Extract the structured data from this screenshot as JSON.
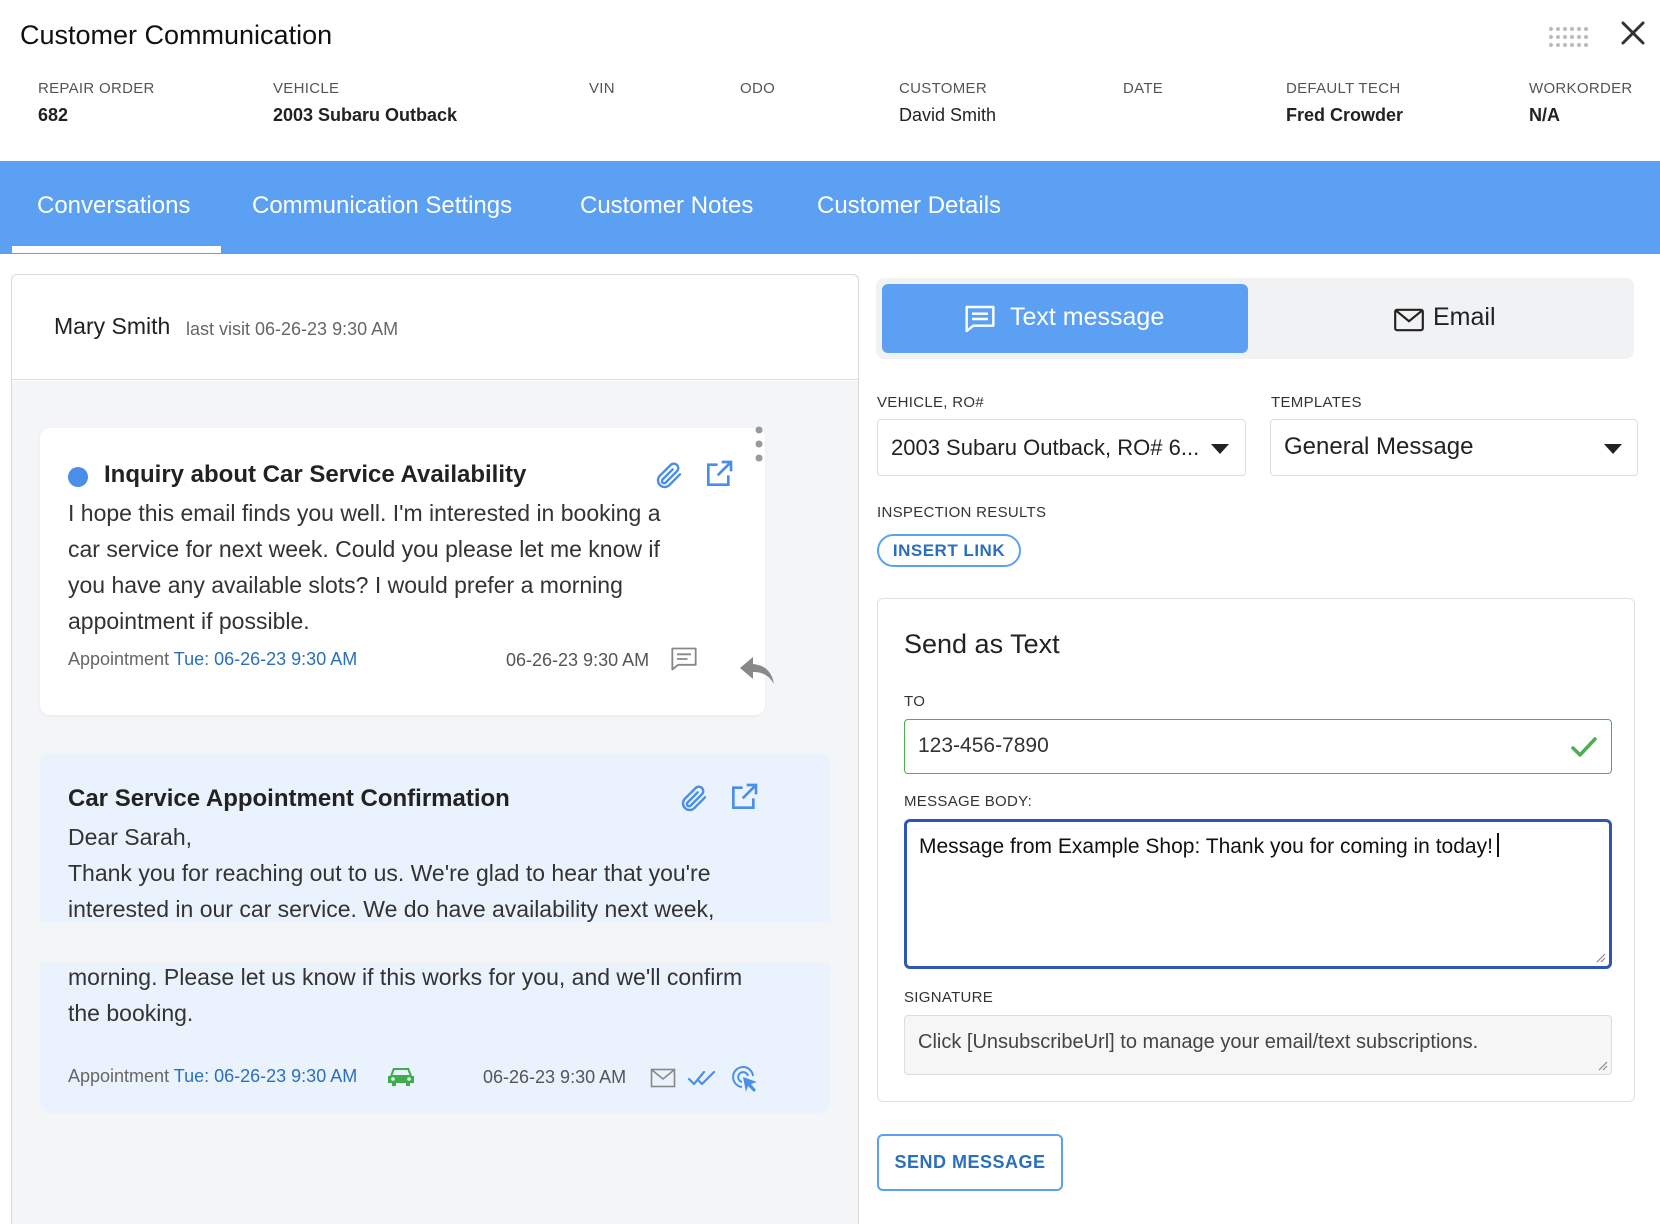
{
  "window": {
    "title": "Customer Communication"
  },
  "meta": [
    {
      "label": "REPAIR ORDER",
      "value": "682"
    },
    {
      "label": "VEHICLE",
      "value": "2003 Subaru Outback"
    },
    {
      "label": "VIN",
      "value": ""
    },
    {
      "label": "ODO",
      "value": ""
    },
    {
      "label": "CUSTOMER",
      "value": "David Smith"
    },
    {
      "label": "DATE",
      "value": ""
    },
    {
      "label": "DEFAULT TECH",
      "value": "Fred Crowder"
    },
    {
      "label": "WORKORDER",
      "value": "N/A"
    }
  ],
  "tabs": [
    {
      "label": "Conversations",
      "active": true
    },
    {
      "label": "Communication Settings"
    },
    {
      "label": "Customer Notes"
    },
    {
      "label": "Customer Details"
    }
  ],
  "conversation": {
    "contact_name": "Mary Smith",
    "last_visit": "last visit 06-26-23 9:30 AM",
    "messages": [
      {
        "subject": "Inquiry about Car Service Availability",
        "unread": true,
        "body_lines": [
          "I hope this email finds you well. I'm interested in booking a",
          "car service for next week. Could you please let me know if",
          "you have any available slots? I would prefer a morning",
          "appointment if possible."
        ],
        "appointment_label": "Appointment",
        "appointment_value": "Tue: 06-26-23 9:30 AM",
        "timestamp": "06-26-23 9:30 AM",
        "channel_icon": "chat-icon"
      },
      {
        "subject": "Car Service Appointment Confirmation",
        "body_lines": [
          "Dear Sarah,",
          "Thank you for reaching out to us. We're glad to hear that you're",
          "interested in our car service. We do have availability next week,",
          "morning. Please let us know if this works for you, and we'll confirm",
          "the booking."
        ],
        "appointment_label": "Appointment",
        "appointment_value": "Tue: 06-26-23 9:30 AM",
        "timestamp": "06-26-23 9:30 AM",
        "channel_icon": "envelope-icon"
      }
    ]
  },
  "composer": {
    "modes": [
      {
        "label": "Text message",
        "icon": "chat-icon",
        "active": true
      },
      {
        "label": "Email",
        "icon": "envelope-icon"
      }
    ],
    "vehicle_label": "VEHICLE, RO#",
    "vehicle_value": "2003 Subaru Outback, RO# 6...",
    "templates_label": "TEMPLATES",
    "templates_value": "General Message",
    "inspection_label": "INSPECTION RESULTS",
    "insert_link": "INSERT LINK",
    "send_title": "Send as Text",
    "to_label": "TO",
    "to_value": "123-456-7890",
    "message_label": "MESSAGE BODY:",
    "message_value": "Message from Example Shop: Thank you for coming in today!",
    "signature_label": "SIGNATURE",
    "signature_value": "Click [UnsubscribeUrl] to manage your email/text subscriptions.",
    "send_button": "SEND MESSAGE"
  },
  "colors": {
    "accent": "#5ba0f2",
    "link": "#2a6fbd",
    "valid": "#4caf50",
    "focus_border": "#2e56b5",
    "car_icon": "#3fae4a"
  }
}
